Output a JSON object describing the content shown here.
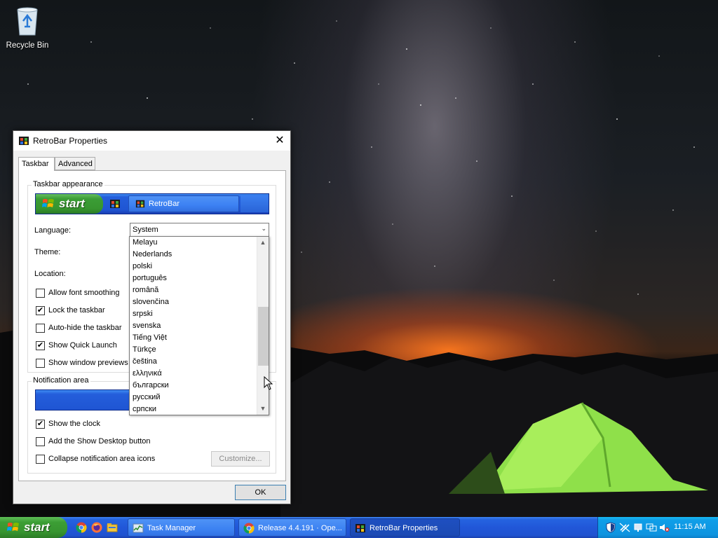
{
  "desktop": {
    "icons": [
      {
        "label": "Recycle Bin",
        "icon": "recycle-bin-icon"
      }
    ]
  },
  "window": {
    "title": "RetroBar Properties",
    "close_glyph": "✕",
    "tabs": [
      {
        "label": "Taskbar",
        "active": true
      },
      {
        "label": "Advanced",
        "active": false
      }
    ],
    "taskbar_appearance": {
      "group_label": "Taskbar appearance",
      "preview_start_label": "start",
      "preview_task_label": "RetroBar"
    },
    "language": {
      "label": "Language:",
      "value": "System"
    },
    "theme": {
      "label": "Theme:"
    },
    "location": {
      "label": "Location:"
    },
    "checkboxes": [
      {
        "label": "Allow font smoothing",
        "checked": false
      },
      {
        "label": "Lock the taskbar",
        "checked": true
      },
      {
        "label": "Auto-hide the taskbar",
        "checked": false
      },
      {
        "label": "Show Quick Launch",
        "checked": true
      },
      {
        "label": "Show window previews",
        "checked": false
      }
    ],
    "notification_area": {
      "group_label": "Notification area",
      "checkboxes": [
        {
          "label": "Show the clock",
          "checked": true
        },
        {
          "label": "Add the Show Desktop button",
          "checked": false
        },
        {
          "label": "Collapse notification area icons",
          "checked": false
        }
      ],
      "customize_label": "Customize..."
    },
    "ok_label": "OK"
  },
  "language_dropdown": {
    "items": [
      "Melayu",
      "Nederlands",
      "polski",
      "português",
      "română",
      "slovenčina",
      "srpski",
      "svenska",
      "Tiếng Việt",
      "Türkçe",
      "čeština",
      "ελληνικά",
      "български",
      "русский",
      "српски"
    ],
    "scroll_up_glyph": "▲",
    "scroll_down_glyph": "▼",
    "scroll_position": 0.55
  },
  "taskbar": {
    "start_label": "start",
    "quick_launch": [
      "chrome-icon",
      "firefox-icon",
      "file-explorer-icon"
    ],
    "tasks": [
      {
        "label": "Task Manager",
        "icon": "task-manager-icon",
        "active": false
      },
      {
        "label": "Release 4.4.191 · Ope...",
        "icon": "chrome-icon",
        "active": false
      },
      {
        "label": "RetroBar Properties",
        "icon": "retrobar-icon",
        "active": true
      }
    ],
    "tray_icons": [
      "security-shield-icon",
      "muted-connection-icon",
      "network-icon",
      "volume-muted-icon"
    ],
    "clock": "11:15 AM"
  },
  "colors": {
    "xp_blue": "#245edb",
    "start_green": "#3c9e35",
    "tray_blue": "#0f9ee8"
  }
}
